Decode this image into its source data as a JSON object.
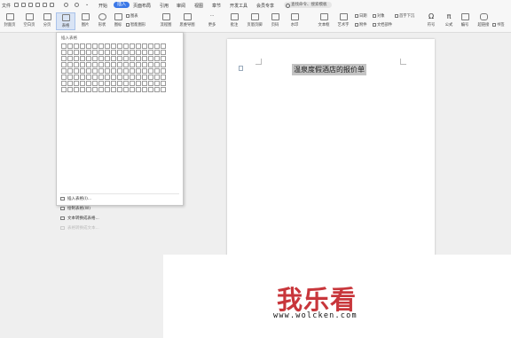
{
  "menubar": {
    "file_label": "文件",
    "tabs": [
      {
        "label": "开始",
        "active": false
      },
      {
        "label": "插入",
        "active": true
      },
      {
        "label": "页面布局",
        "active": false
      },
      {
        "label": "引用",
        "active": false
      },
      {
        "label": "审阅",
        "active": false
      },
      {
        "label": "视图",
        "active": false
      },
      {
        "label": "章节",
        "active": false
      },
      {
        "label": "开发工具",
        "active": false
      },
      {
        "label": "会员专享",
        "active": false
      }
    ],
    "search_label": "查找命令、搜索模板"
  },
  "ribbon": {
    "buttons": [
      {
        "name": "cover-page",
        "label": "封面页"
      },
      {
        "name": "blank-page",
        "label": "空白页"
      },
      {
        "name": "page-break",
        "label": "分页"
      },
      {
        "name": "table",
        "label": "表格"
      },
      {
        "name": "picture",
        "label": "图片"
      },
      {
        "name": "shapes",
        "label": "形状"
      },
      {
        "name": "icons",
        "label": "图标"
      },
      {
        "name": "stream-chart",
        "label": "流程图"
      },
      {
        "name": "mind-map",
        "label": "思维导图"
      },
      {
        "name": "more",
        "label": "更多"
      },
      {
        "name": "annotation",
        "label": "批注"
      },
      {
        "name": "header-footer",
        "label": "页眉页脚"
      },
      {
        "name": "page-number",
        "label": "页码"
      },
      {
        "name": "watermark",
        "label": "水印"
      },
      {
        "name": "text-box",
        "label": "文本框"
      },
      {
        "name": "art-text",
        "label": "艺术字"
      },
      {
        "name": "symbol",
        "label": "符号"
      },
      {
        "name": "formula",
        "label": "公式"
      },
      {
        "name": "numbering",
        "label": "编号"
      },
      {
        "name": "hyperlink",
        "label": "超链接"
      }
    ],
    "small_items": {
      "chart": "图表",
      "smart_art": "智能图形",
      "date": "日期",
      "attachment": "附件",
      "object": "对象",
      "doc_parts": "文档部件",
      "first_drop": "首字下沉",
      "bookmark": "书签"
    }
  },
  "table_menu": {
    "title": "插入表格",
    "grid_rows": 8,
    "grid_cols": 17,
    "items": [
      {
        "label": "插入表格(I)...",
        "enabled": true
      },
      {
        "label": "绘制表格(W)",
        "enabled": true
      },
      {
        "label": "文本转换成表格...",
        "enabled": true
      },
      {
        "label": "表格转换成文本...",
        "enabled": false
      }
    ]
  },
  "document": {
    "title": "温泉度假酒店的报价单"
  },
  "watermark": {
    "text": "我乐看",
    "url": "www.wolcken.com"
  }
}
